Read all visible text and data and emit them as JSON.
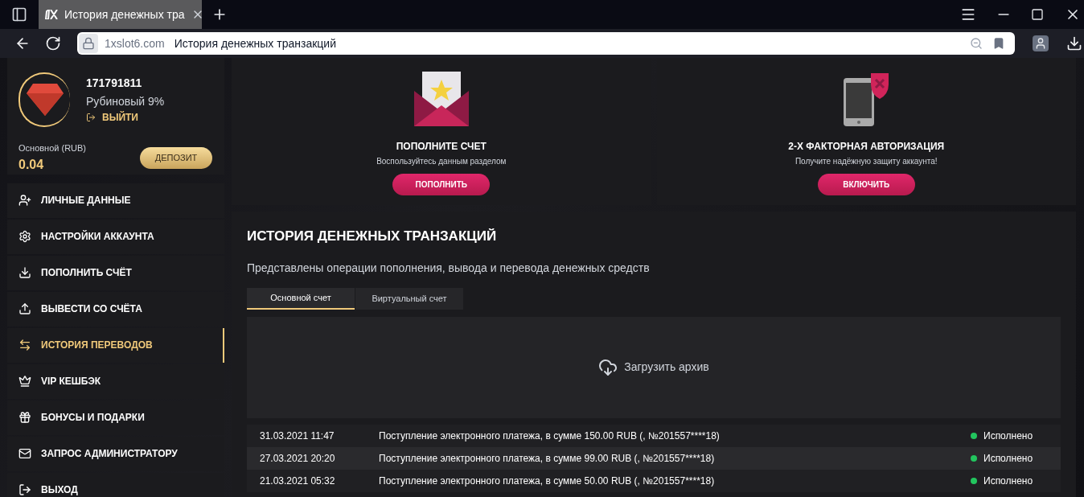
{
  "browser": {
    "tab_title": "История денежных тра",
    "url_domain": "1xslot6.com",
    "url_title": "История денежных транзакций"
  },
  "profile": {
    "user_id": "171791811",
    "level": "Рубиновый 9%",
    "logout": "ВЫЙТИ",
    "balance_label": "Основной (RUB)",
    "balance": "0.04",
    "deposit_button": "ДЕПОЗИТ"
  },
  "menu": [
    {
      "label": "ЛИЧНЫЕ ДАННЫЕ",
      "selected": false
    },
    {
      "label": "НАСТРОЙКИ АККАУНТА",
      "selected": false
    },
    {
      "label": "ПОПОЛНИТЬ СЧЁТ",
      "selected": false
    },
    {
      "label": "ВЫВЕСТИ СО СЧЁТА",
      "selected": false
    },
    {
      "label": "ИСТОРИЯ ПЕРЕВОДОВ",
      "selected": true
    },
    {
      "label": "VIP КЕШБЭК",
      "selected": false
    },
    {
      "label": "БОНУСЫ И ПОДАРКИ",
      "selected": false
    },
    {
      "label": "ЗАПРОС АДМИНИСТРАТОРУ",
      "selected": false
    },
    {
      "label": "ВЫХОД",
      "selected": false
    }
  ],
  "promo_cards": [
    {
      "title": "ПОПОЛНИТЕ СЧЕТ",
      "subtitle": "Воспользуйтесь данным разделом",
      "button": "ПОПОЛНИТЬ"
    },
    {
      "title": "2-Х ФАКТОРНАЯ АВТОРИЗАЦИЯ",
      "subtitle": "Получите надёжную защиту аккаунта!",
      "button": "ВКЛЮЧИТЬ"
    }
  ],
  "history": {
    "title": "ИСТОРИЯ ДЕНЕЖНЫХ ТРАНЗАКЦИЙ",
    "description": "Представлены операции пополнения, вывода и перевода денежных средств",
    "tabs": [
      {
        "label": "Основной счет",
        "selected": true
      },
      {
        "label": "Виртуальный счет",
        "selected": false
      }
    ],
    "download_archive": "Загрузить архив",
    "rows": [
      {
        "date": "31.03.2021 11:47",
        "description": "Поступление электронного платежа, в сумме 150.00 RUB (, №201557****18)",
        "status": "Исполнено"
      },
      {
        "date": "27.03.2021 20:20",
        "description": "Поступление электронного платежа, в сумме 99.00 RUB (, №201557****18)",
        "status": "Исполнено"
      },
      {
        "date": "21.03.2021 05:32",
        "description": "Поступление электронного платежа, в сумме 50.00 RUB (, №201557****18)",
        "status": "Исполнено"
      }
    ]
  }
}
